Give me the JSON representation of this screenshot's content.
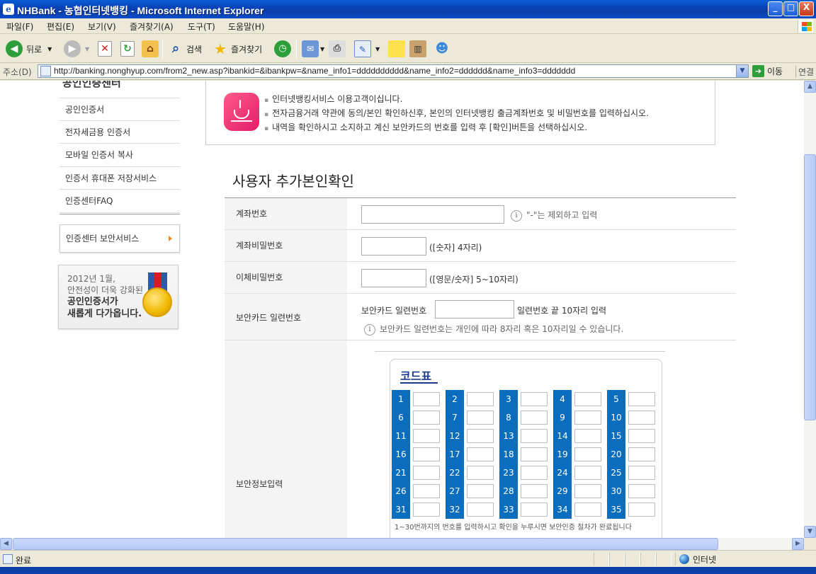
{
  "window": {
    "title": "NHBank - 농협인터넷뱅킹 - Microsoft Internet Explorer",
    "minimize": "_",
    "maximize": "□",
    "close": "X"
  },
  "menu": [
    "파일(F)",
    "편집(E)",
    "보기(V)",
    "즐겨찾기(A)",
    "도구(T)",
    "도움말(H)"
  ],
  "toolbar": {
    "back": "뒤로",
    "search": "검색",
    "favorites": "즐겨찾기"
  },
  "address": {
    "label": "주소(D)",
    "url": "http://banking.nonghyup.com/from2_new.asp?ibankid=&ibankpw=&name_info1=dddddddddd&name_info2=dddddd&name_info3=ddddddd",
    "go": "이동",
    "links": "연결"
  },
  "sidebar": {
    "heading": "공인인증센터",
    "items": [
      "공인인증서",
      "전자세금용 인증서",
      "모바일 인증서 복사",
      "인증서 휴대폰 저장서비스",
      "인증센터FAQ"
    ],
    "security_button": "인증센터 보안서비스",
    "banner_line1": "2012년 1월,",
    "banner_line2": "안전성이 더욱 강화된",
    "banner_line3": "공인인증서가",
    "banner_line4": "새롭게 다가옵니다."
  },
  "notice": [
    "인터넷뱅킹서비스 이용고객이십니다.",
    "전자금융거래 약관에 동의/본인 확인하신후, 본인의 인터넷뱅킹 출금계좌번호 및 비밀번호를 입력하십시오.",
    "내역을 확인하시고 소지하고 계신 보안카드의 번호를 입력 후 [확인]버튼을 선택하십시오."
  ],
  "page_title": "사용자 추가본인확인",
  "form": {
    "account_label": "계좌번호",
    "account_hint": "\"-\"는 제외하고 입력",
    "account_pw_label": "계좌비밀번호",
    "account_pw_hint": "([숫자] 4자리)",
    "transfer_pw_label": "이체비밀번호",
    "transfer_pw_hint": "([영문/숫자] 5~10자리)",
    "card_serial_label": "보안카드 일련번호",
    "card_serial_prefix": "보안카드 일련번호",
    "card_serial_suffix": "일련번호 끝 10자리 입력",
    "card_serial_note": "보안카드 일련번호는 개인에 따라 8자리 혹은 10자리일 수 있습니다.",
    "security_input_label": "보안정보입력"
  },
  "codetable": {
    "title": "코드표",
    "numbers": [
      "1",
      "2",
      "3",
      "4",
      "5",
      "6",
      "7",
      "8",
      "9",
      "10",
      "11",
      "12",
      "13",
      "14",
      "15",
      "16",
      "17",
      "18",
      "19",
      "20",
      "21",
      "22",
      "23",
      "24",
      "25",
      "26",
      "27",
      "28",
      "29",
      "30",
      "31",
      "32",
      "33",
      "34",
      "35"
    ],
    "note": "1~30번까지의 번호를 입력하시고 확인을 누루시면 보안인증 절차가 완료됩니다"
  },
  "status": {
    "text": "완료",
    "zone": "인터넷"
  }
}
